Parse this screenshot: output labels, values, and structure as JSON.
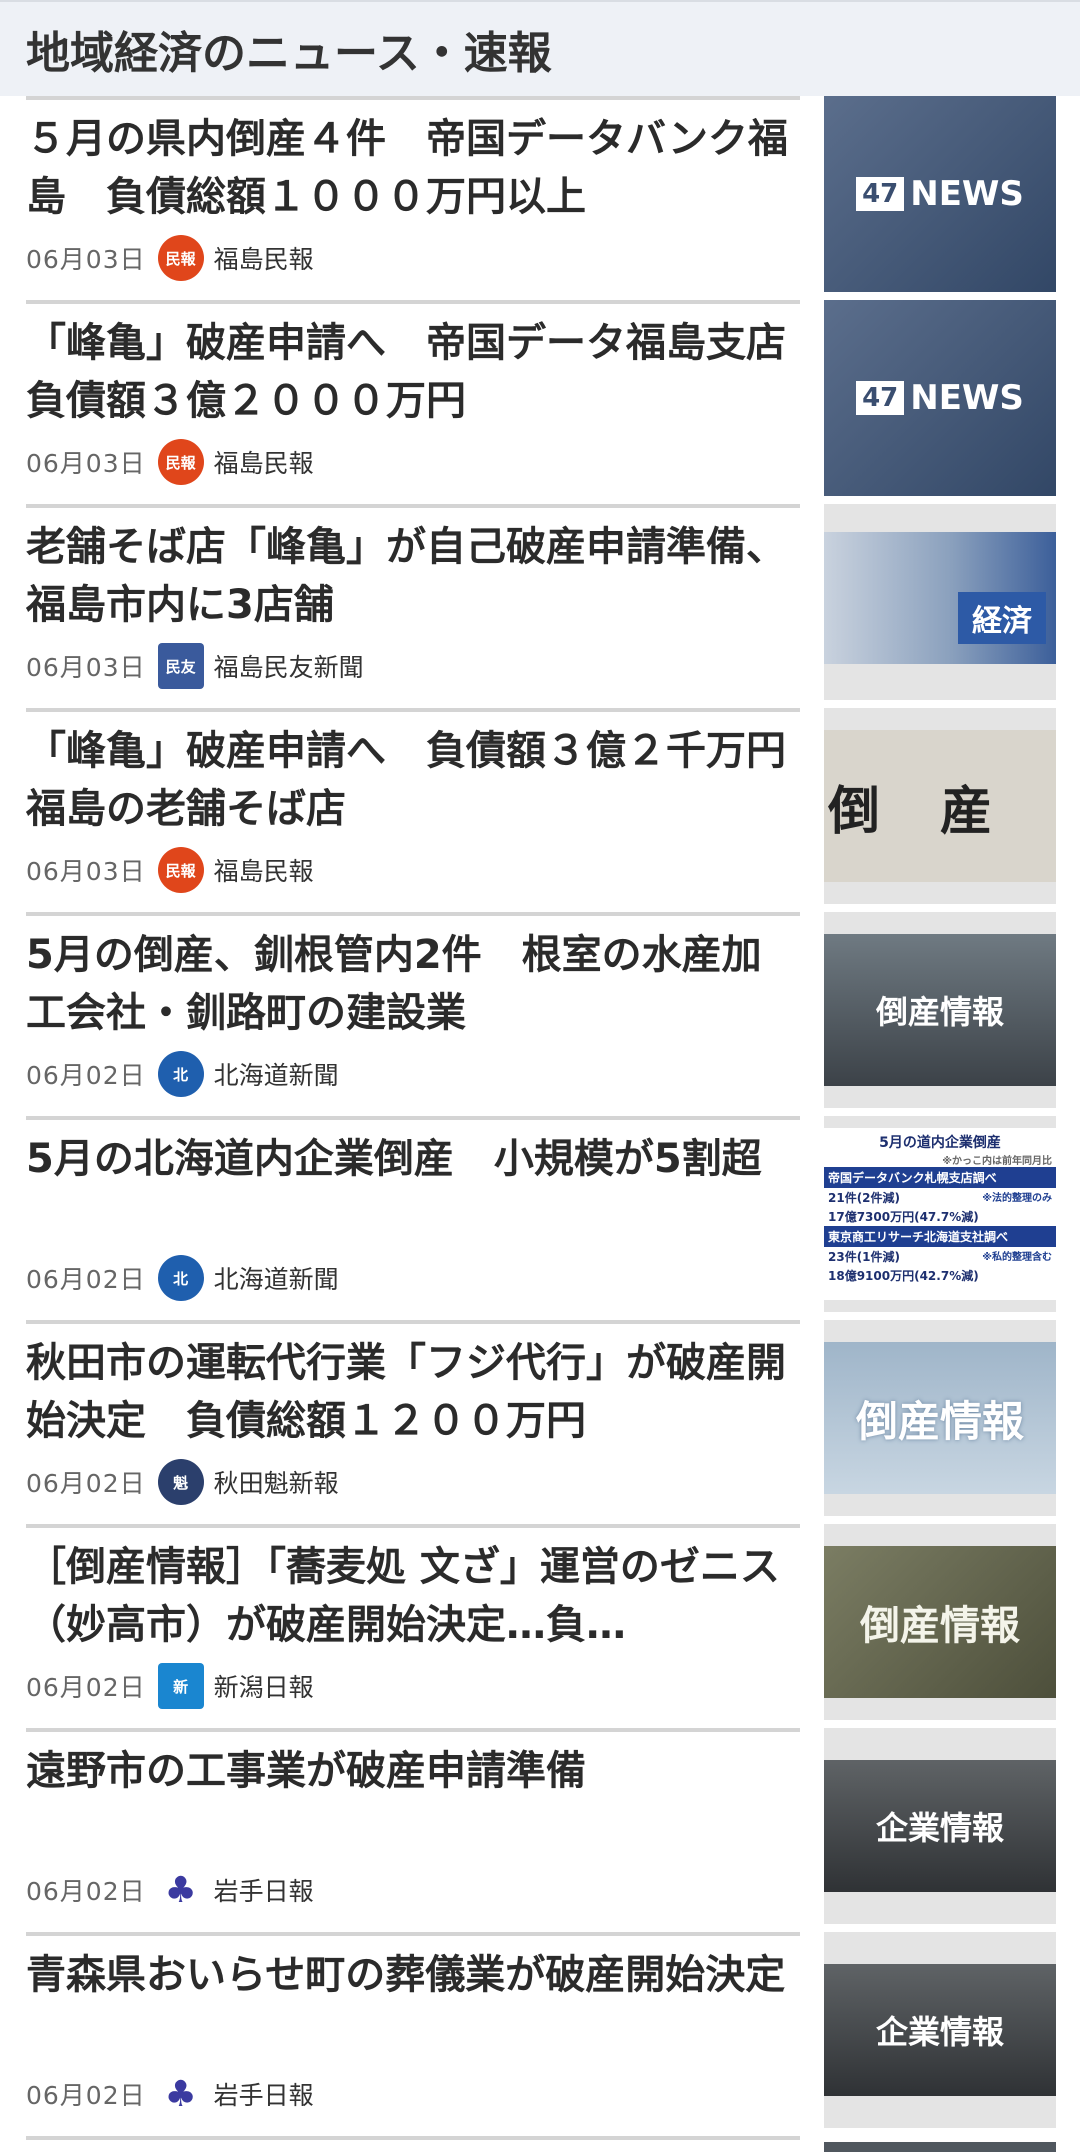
{
  "section": {
    "title": "地域経済のニュース・速報"
  },
  "items": [
    {
      "title": "５月の県内倒産４件　帝国データバンク福島　負債総額１０００万円以上",
      "date": "06月03日",
      "source": "福島民報",
      "logo_text": "民報",
      "logo_color": "#e0461b",
      "thumb_label": "NEWS",
      "thumb_num": "47"
    },
    {
      "title": "「峰亀」破産申請へ　帝国データ福島支店　負債額３億２０００万円",
      "date": "06月03日",
      "source": "福島民報",
      "logo_text": "民報",
      "logo_color": "#e0461b",
      "thumb_label": "NEWS",
      "thumb_num": "47"
    },
    {
      "title": "老舗そば店「峰亀」が自己破産申請準備、福島市内に3店舗",
      "date": "06月03日",
      "source": "福島民友新聞",
      "logo_text": "民友",
      "logo_color": "#3a5a9c",
      "thumb_label": "経済"
    },
    {
      "title": "「峰亀」破産申請へ　負債額３億２千万円　福島の老舗そば店",
      "date": "06月03日",
      "source": "福島民報",
      "logo_text": "民報",
      "logo_color": "#e0461b",
      "thumb_label": "倒産"
    },
    {
      "title": "5月の倒産、釧根管内2件　根室の水産加工会社・釧路町の建設業",
      "date": "06月02日",
      "source": "北海道新聞",
      "logo_text": "北",
      "logo_color": "#1f5fae",
      "thumb_label": "倒産情報"
    },
    {
      "title": "5月の北海道内企業倒産　小規模が5割超",
      "date": "06月02日",
      "source": "北海道新聞",
      "logo_text": "北",
      "logo_color": "#1f5fae",
      "thumb_table": {
        "title": "5月の道内企業倒産",
        "note": "※かっこ内は前年同月比",
        "bar1": "帝国データバンク札幌支店調べ",
        "bar1_note": "※法的整理のみ",
        "row1a": "21件(2件減)",
        "row1b": "17億7300万円(47.7%減)",
        "bar2": "東京商工リサーチ北海道支社調べ",
        "bar2_note": "※私的整理含む",
        "row2a": "23件(1件減)",
        "row2b": "18億9100万円(42.7%減)"
      }
    },
    {
      "title": "秋田市の運転代行業「フジ代行」が破産開始決定　負債総額１２００万円",
      "date": "06月02日",
      "source": "秋田魁新報",
      "logo_text": "魁",
      "logo_color": "#2b3f6c",
      "thumb_label": "倒産情報"
    },
    {
      "title": "［倒産情報］「蕎麦処 文ざ」運営のゼニス（妙高市）が破産開始決定…負…",
      "date": "06月02日",
      "source": "新潟日報",
      "logo_text": "新",
      "logo_color": "#1a86d0",
      "thumb_label": "倒産情報"
    },
    {
      "title": "遠野市の工事業が破産申請準備",
      "date": "06月02日",
      "source": "岩手日報",
      "logo_text": "♣",
      "logo_color": "#3b3aa0",
      "thumb_label": "企業情報"
    },
    {
      "title": "青森県おいらせ町の葬儀業が破産開始決定",
      "date": "06月02日",
      "source": "岩手日報",
      "logo_text": "♣",
      "logo_color": "#3b3aa0",
      "thumb_label": "企業情報"
    }
  ]
}
